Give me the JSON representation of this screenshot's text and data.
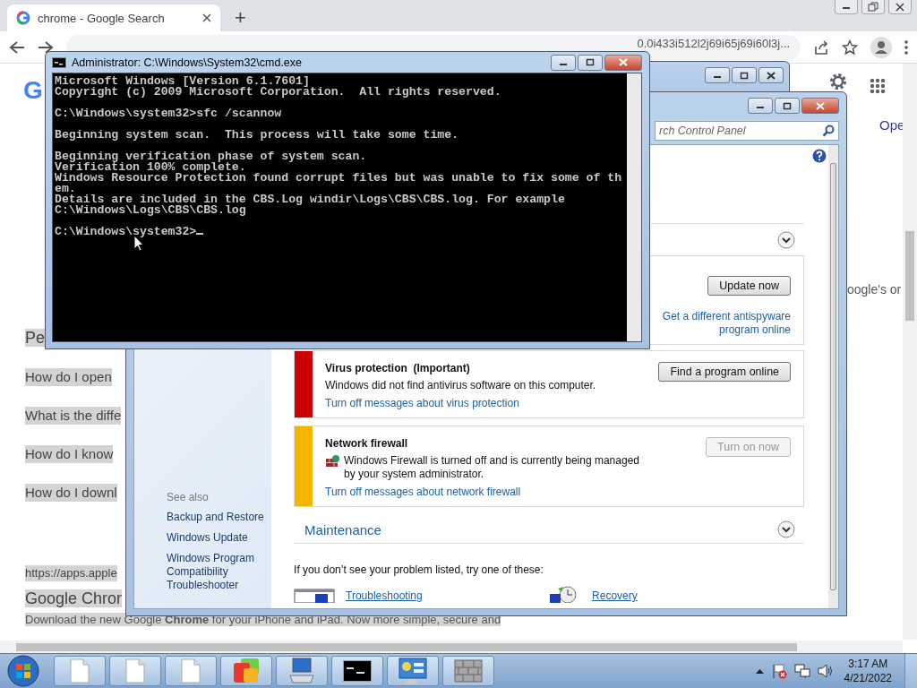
{
  "browser": {
    "tab": {
      "title": "chrome - Google Search",
      "selected": true
    },
    "new_tab": "+",
    "address_tail": "0.0i433i512l2j69i65j69i60l3j...",
    "logo_fragment": "G",
    "left_results": [
      {
        "kind": "heading",
        "text": "Pe"
      },
      {
        "kind": "question",
        "text": "How do I open"
      },
      {
        "kind": "question",
        "text": "What is the diffe"
      },
      {
        "kind": "question",
        "text": "How do I know"
      },
      {
        "kind": "question",
        "text": "How do I downl"
      },
      {
        "kind": "url",
        "text": "https://apps.apple"
      },
      {
        "kind": "heading",
        "text": "Google Chror"
      },
      {
        "kind": "snippet",
        "text": "Download the new Google **Chrome** for your iPhone and iPad. Now more simple, secure and"
      }
    ],
    "right_results": [
      {
        "kind": "link",
        "text": "Ope"
      },
      {
        "kind": "snippet",
        "text": "oogle's or"
      }
    ]
  },
  "cmd": {
    "title": "Administrator: C:\\Windows\\System32\\cmd.exe",
    "blocks": [
      [
        "Microsoft Windows [Version 6.1.7601]",
        "Copyright (c) 2009 Microsoft Corporation.  All rights reserved."
      ],
      [
        "C:\\Windows\\system32>sfc /scannow"
      ],
      [
        "Beginning system scan.  This process will take some time."
      ],
      [
        "Beginning verification phase of system scan.",
        "Verification 100% complete.",
        "Windows Resource Protection found corrupt files but was unable to fix some of th",
        "em.",
        "Details are included in the CBS.Log windir\\Logs\\CBS\\CBS.log. For example",
        "C:\\Windows\\Logs\\CBS\\CBS.log"
      ],
      [
        "C:\\Windows\\system32>"
      ]
    ]
  },
  "control_panel": {
    "search_placeholder": "rch Control Panel",
    "spyware": {
      "button": "Update now",
      "link": "Get a different antispyware program online"
    },
    "alerts": [
      {
        "kind": "virus",
        "color": "#cc0000",
        "title": "Virus protection  (Important)",
        "message": "Windows did not find antivirus software on this computer.",
        "button": {
          "label": "Find a program online",
          "disabled": false
        },
        "link": "Turn off messages about virus protection"
      },
      {
        "kind": "firewall",
        "color": "#f2b600",
        "title": "Network firewall",
        "message": "Windows Firewall is turned off and is currently being managed by your system administrator.",
        "button": {
          "label": "Turn on now",
          "disabled": true
        },
        "link": "Turn off messages about network firewall"
      }
    ],
    "maintenance": "Maintenance",
    "footer": "If you don’t see your problem listed, try one of these:",
    "options": [
      {
        "kind": "troubleshooting",
        "label": "Troubleshooting"
      },
      {
        "kind": "recovery",
        "label": "Recovery"
      }
    ],
    "see_also": {
      "heading": "See also",
      "links": [
        "Backup and Restore",
        "Windows Update",
        "Windows Program Compatibility Troubleshooter"
      ]
    }
  },
  "taskbar": {
    "buttons": [
      {
        "kind": "document"
      },
      {
        "kind": "document"
      },
      {
        "kind": "document"
      },
      {
        "kind": "app"
      },
      {
        "kind": "computer"
      },
      {
        "kind": "console"
      },
      {
        "kind": "control-panel"
      },
      {
        "kind": "firewall"
      }
    ],
    "time": "3:17 AM",
    "date": "4/21/2022"
  }
}
